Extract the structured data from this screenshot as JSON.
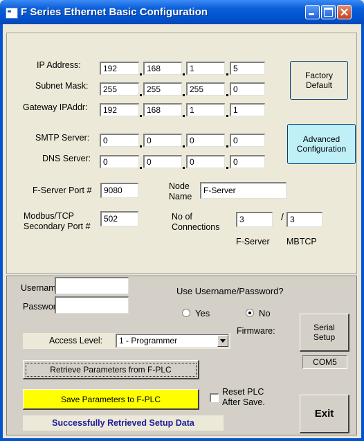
{
  "window": {
    "title": "F Series Ethernet  Basic Configuration"
  },
  "network": {
    "ip_label": "IP Address:",
    "ip": [
      "192",
      "168",
      "1",
      "5"
    ],
    "subnet_label": "Subnet Mask:",
    "subnet": [
      "255",
      "255",
      "255",
      "0"
    ],
    "gateway_label": "Gateway IPAddr:",
    "gateway": [
      "192",
      "168",
      "1",
      "1"
    ],
    "smtp_label": "SMTP Server:",
    "smtp": [
      "0",
      "0",
      "0",
      "0"
    ],
    "dns_label": "DNS Server:",
    "dns": [
      "0",
      "0",
      "0",
      "0"
    ],
    "fserver_port_label": "F-Server Port #",
    "fserver_port": "9080",
    "modbus_label_1": "Modbus/TCP",
    "modbus_label_2": "Secondary Port #",
    "modbus_port": "502",
    "node_label_1": "Node",
    "node_label_2": "Name",
    "node_name": "F-Server",
    "conn_label_1": "No of",
    "conn_label_2": "Connections",
    "fserver_conn": "3",
    "mbtcp_conn": "3",
    "slash": "/",
    "fserver_caption": "F-Server",
    "mbtcp_caption": "MBTCP"
  },
  "buttons": {
    "factory_1": "Factory",
    "factory_2": "Default",
    "advanced_1": "Advanced",
    "advanced_2": "Configuration",
    "serial_1": "Serial",
    "serial_2": "Setup",
    "retrieve": "Retrieve Parameters from F-PLC",
    "save": "Save Parameters  to F-PLC",
    "exit": "Exit"
  },
  "auth": {
    "username_label": "Username:",
    "username": "",
    "password_label": "Password:",
    "password": "",
    "use_label": "Use Username/Password?",
    "yes": "Yes",
    "no": "No",
    "selected": "No",
    "firmware_label": "Firmware:"
  },
  "access": {
    "label": "Access Level:",
    "value": "1 - Programmer"
  },
  "com_port": "COM5",
  "reset": {
    "label_1": "Reset PLC",
    "label_2": "After Save.",
    "checked": false
  },
  "status": "Successfully Retrieved Setup Data",
  "colors": {
    "save_bg": "#ffff00",
    "advanced_bg": "#bff0f8",
    "status_text": "#1c1c9c"
  }
}
